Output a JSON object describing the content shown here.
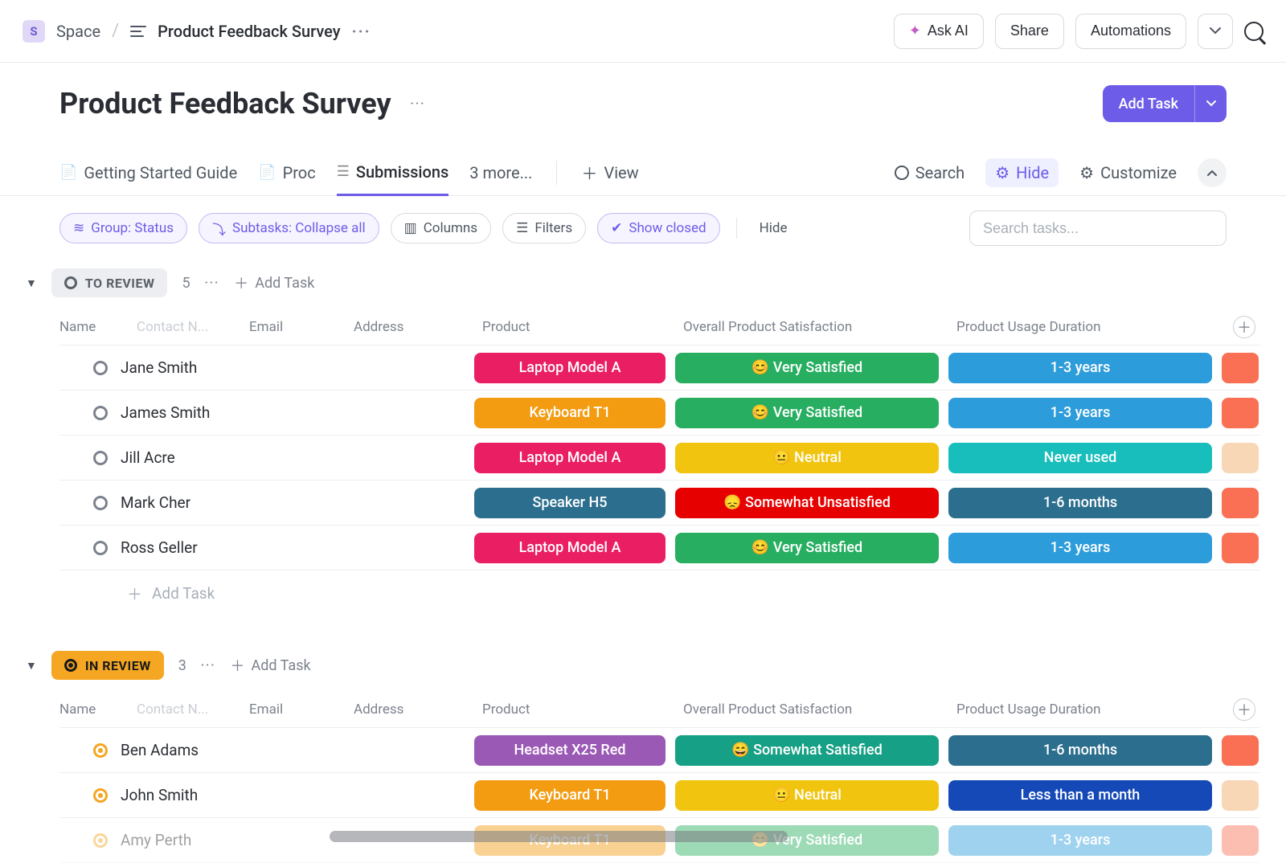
{
  "breadcrumb": {
    "space_badge": "S",
    "space_label": "Space",
    "page_title": "Product Feedback Survey"
  },
  "top_actions": {
    "ask_ai": "Ask AI",
    "share": "Share",
    "automations": "Automations"
  },
  "header": {
    "title": "Product Feedback Survey",
    "add_task": "Add Task"
  },
  "tabs": {
    "items": [
      {
        "label": "Getting Started Guide"
      },
      {
        "label": "Proc"
      },
      {
        "label": "Submissions"
      },
      {
        "label": "3 more..."
      }
    ],
    "view": "View",
    "search": "Search",
    "hide": "Hide",
    "customize": "Customize"
  },
  "filters": {
    "group": "Group: Status",
    "subtasks": "Subtasks: Collapse all",
    "columns": "Columns",
    "filters": "Filters",
    "show_closed": "Show closed",
    "hide": "Hide",
    "search_placeholder": "Search tasks..."
  },
  "columns": {
    "name": "Name",
    "contact": "Contact N...",
    "email": "Email",
    "address": "Address",
    "product": "Product",
    "satisfaction": "Overall Product Satisfaction",
    "duration": "Product Usage Duration"
  },
  "groups": [
    {
      "key": "to_review",
      "label": "TO REVIEW",
      "count": "5",
      "style": "todo",
      "add_task_label": "Add Task",
      "rows": [
        {
          "name": "Jane Smith",
          "product": {
            "text": "Laptop Model A",
            "bg": "#ea1e63"
          },
          "satisfaction": {
            "text": "😊 Very Satisfied",
            "bg": "#27ae60"
          },
          "duration": {
            "text": "1-3 years",
            "bg": "#2d9cdb"
          },
          "extra_bg": "#f97054"
        },
        {
          "name": "James Smith",
          "product": {
            "text": "Keyboard T1",
            "bg": "#f39c12"
          },
          "satisfaction": {
            "text": "😊 Very Satisfied",
            "bg": "#27ae60"
          },
          "duration": {
            "text": "1-3 years",
            "bg": "#2d9cdb"
          },
          "extra_bg": "#f97054"
        },
        {
          "name": "Jill Acre",
          "product": {
            "text": "Laptop Model A",
            "bg": "#ea1e63"
          },
          "satisfaction": {
            "text": "😐 Neutral",
            "bg": "#f1c40f"
          },
          "duration": {
            "text": "Never used",
            "bg": "#17bebb"
          },
          "extra_bg": "#f8d7b6"
        },
        {
          "name": "Mark Cher",
          "product": {
            "text": "Speaker H5",
            "bg": "#2c6e8e"
          },
          "satisfaction": {
            "text": "😞 Somewhat Unsatisfied",
            "bg": "#e60000"
          },
          "duration": {
            "text": "1-6 months",
            "bg": "#2c6e8e"
          },
          "extra_bg": "#f97054"
        },
        {
          "name": "Ross Geller",
          "product": {
            "text": "Laptop Model A",
            "bg": "#ea1e63"
          },
          "satisfaction": {
            "text": "😊 Very Satisfied",
            "bg": "#27ae60"
          },
          "duration": {
            "text": "1-3 years",
            "bg": "#2d9cdb"
          },
          "extra_bg": "#f97054"
        }
      ],
      "footer_add_task": "Add Task"
    },
    {
      "key": "in_review",
      "label": "IN REVIEW",
      "count": "3",
      "style": "inreview",
      "add_task_label": "Add Task",
      "rows": [
        {
          "name": "Ben Adams",
          "product": {
            "text": "Headset X25 Red",
            "bg": "#9b59b6"
          },
          "satisfaction": {
            "text": "😄 Somewhat Satisfied",
            "bg": "#16a085"
          },
          "duration": {
            "text": "1-6 months",
            "bg": "#2c6e8e"
          },
          "extra_bg": "#f97054"
        },
        {
          "name": "John Smith",
          "product": {
            "text": "Keyboard T1",
            "bg": "#f39c12"
          },
          "satisfaction": {
            "text": "😐 Neutral",
            "bg": "#f1c40f"
          },
          "duration": {
            "text": "Less than a month",
            "bg": "#1549b8"
          },
          "extra_bg": "#f8d7b6"
        },
        {
          "name": "Amy Perth",
          "product": {
            "text": "Keyboard T1",
            "bg": "#f39c12"
          },
          "satisfaction": {
            "text": "😊 Very Satisfied",
            "bg": "#27ae60"
          },
          "duration": {
            "text": "1-3 years",
            "bg": "#2d9cdb"
          },
          "extra_bg": "#f97054",
          "fading": true
        }
      ]
    }
  ]
}
